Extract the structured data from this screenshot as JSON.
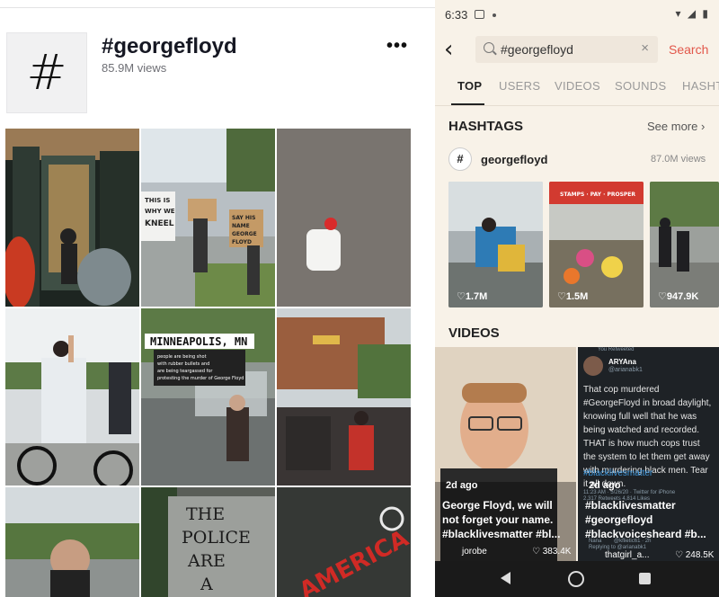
{
  "left": {
    "hashtag_symbol": "#",
    "title": "#georgefloyd",
    "views": "85.9M views",
    "more_glyph": "•••",
    "overlay_texts": {
      "sign1": "THIS IS WHY WE KNEEL",
      "sign2": "SAY HIS NAME GEORGE FLOYD",
      "city": "MINNEAPOLIS, MN",
      "city_sub": "people are being shot with rubber bullets and are being teargassed for protesting the murder of George Floyd",
      "door_text": "THE POLICE ARE A",
      "graffiti": "AMERICA"
    }
  },
  "phone": {
    "status": {
      "time": "6:33",
      "right_icons": "▾ ◢ ▮"
    },
    "search": {
      "query": "#georgefloyd",
      "clear": "×",
      "action": "Search"
    },
    "tabs": [
      "TOP",
      "USERS",
      "VIDEOS",
      "SOUNDS",
      "HASHT"
    ],
    "hashtags": {
      "heading": "HASHTAGS",
      "see_more": "See more ›",
      "symbol": "#",
      "name": "georgefloyd",
      "views": "87.0M views",
      "thumbs": [
        {
          "likes": "♡1.7M"
        },
        {
          "likes": "♡1.5M",
          "sign": "STAMPS · PAY · PROSPER"
        },
        {
          "likes": "♡947.9K"
        }
      ]
    },
    "videos": {
      "heading": "VIDEOS",
      "items": [
        {
          "ago": "2d ago",
          "caption_line1": "George Floyd, we will",
          "caption_line2": "not forget your name.",
          "caption_line3": "#blacklivesmatter #bl...",
          "user": "jorobe",
          "likes": "♡ 383.4K"
        },
        {
          "retweeted": "You Retweeted",
          "author": "ARYAna",
          "handle": "@arianabk1",
          "tweet": "That cop murdered #GeorgeFloyd in broad daylight, knowing full well that he was being watched and recorded. THAT is how much cops trust the system to let them get away with murdering black men. Tear it all down.",
          "tag": "#blacklivesmatter",
          "stamp": "11:23 AM · 5/26/20 · Twitter for iPhone",
          "counts": "2,317 Retweets  4,814 Likes",
          "ago": "2d ago",
          "caption_line1": "#blacklivesmatter",
          "caption_line2": "#georgefloyd",
          "caption_line3": "#blackvoicesheard #b...",
          "reply_name": "Nana",
          "reply_handle": "@kflietic61 · 2h",
          "reply_to": "Replying to @arianabk1",
          "user": "thatgirl_a...",
          "likes": "♡ 248.5K"
        }
      ]
    }
  }
}
